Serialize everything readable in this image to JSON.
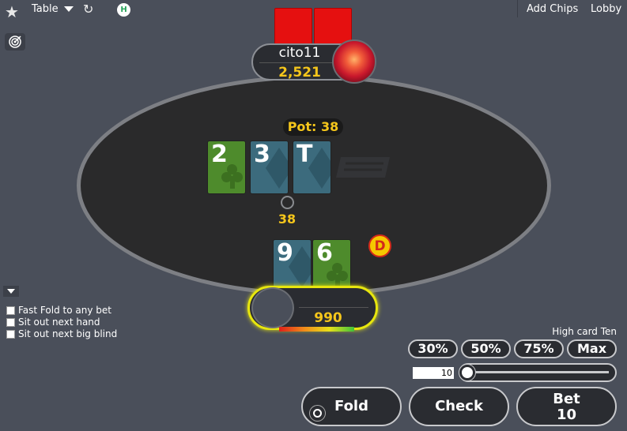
{
  "topbar": {
    "star_icon": "★",
    "table_menu_label": "Table",
    "refresh_icon": "↻",
    "h_badge": "H",
    "add_chips_label": "Add Chips",
    "lobby_label": "Lobby"
  },
  "opponent": {
    "name": "cito11",
    "stack": "2,521"
  },
  "table": {
    "pot_label": "Pot: 38",
    "board": [
      {
        "rank": "2",
        "suit": "club"
      },
      {
        "rank": "3",
        "suit": "diamond"
      },
      {
        "rank": "T",
        "suit": "diamond"
      }
    ],
    "bet_amount": "38",
    "dealer_label": "D"
  },
  "hero": {
    "cards": [
      {
        "rank": "9",
        "suit": "diamond"
      },
      {
        "rank": "6",
        "suit": "club"
      }
    ],
    "stack": "990",
    "timer_remaining_fraction": 1.0
  },
  "options": {
    "fast_fold": "Fast Fold to any bet",
    "sit_out_hand": "Sit out next hand",
    "sit_out_bb": "Sit out next big blind"
  },
  "controls": {
    "hand_strength": "High card Ten",
    "presets": [
      "30%",
      "50%",
      "75%",
      "Max"
    ],
    "bet_value": "10",
    "slider_fraction": 0.0,
    "fold_label": "Fold",
    "check_label": "Check",
    "bet_label": "Bet",
    "bet_button_amount": "10"
  },
  "colors": {
    "background": "#4a4f5a",
    "accent_gold": "#f5c61b",
    "active_ring": "#e7e60e",
    "card_back": "#e51010",
    "club_card": "#4e8b2c",
    "diamond_card": "#3c6b7d"
  }
}
